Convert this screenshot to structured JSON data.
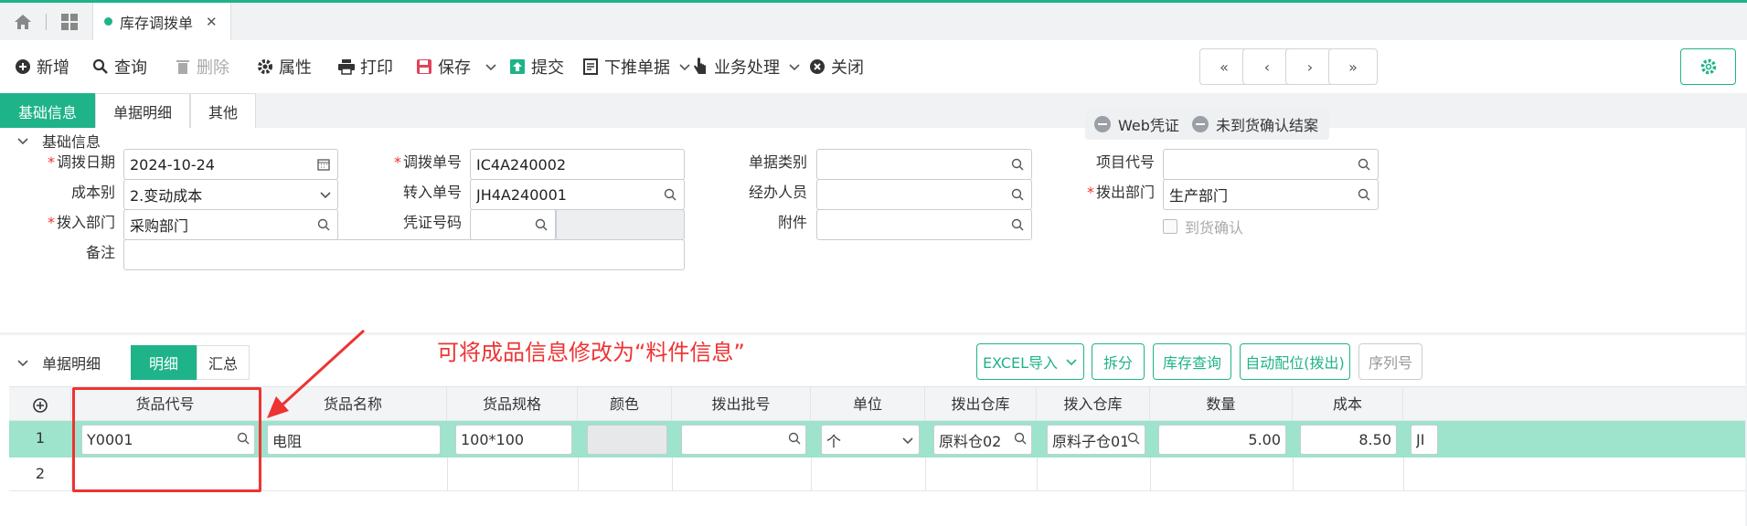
{
  "tabbar": {
    "active_tab": "库存调拨单",
    "close_glyph": "✕"
  },
  "toolbar": {
    "buttons": [
      "新增",
      "查询",
      "删除",
      "属性",
      "打印",
      "保存",
      "提交",
      "下推单据",
      "业务处理",
      "关闭"
    ],
    "nav": [
      "«",
      "‹",
      "›",
      "»"
    ]
  },
  "subtabs": [
    "基础信息",
    "单据明细",
    "其他"
  ],
  "basic": {
    "section_title": "基础信息",
    "pills": [
      "Web凭证",
      "未到货确认结案"
    ],
    "fields": {
      "date_label": "调拨日期",
      "date_value": "2024-10-24",
      "cost_label": "成本别",
      "cost_value": "2.变动成本",
      "in_dept_label": "拨入部门",
      "in_dept_value": "采购部门",
      "remark_label": "备注",
      "remark_value": "",
      "no_label": "调拨单号",
      "no_value": "IC4A240002",
      "in_no_label": "转入单号",
      "in_no_value": "JH4A240001",
      "voucher_label": "凭证号码",
      "voucher_value": "",
      "category_label": "单据类别",
      "category_value": "",
      "handler_label": "经办人员",
      "handler_value": "",
      "attach_label": "附件",
      "attach_value": "",
      "project_label": "项目代号",
      "project_value": "",
      "out_dept_label": "拨出部门",
      "out_dept_value": "生产部门",
      "arrive_label": "到货确认"
    }
  },
  "detail": {
    "section_title": "单据明细",
    "seg": [
      "明细",
      "汇总"
    ],
    "buttons": [
      "EXCEL导入",
      "拆分",
      "库存查询",
      "自动配位(拨出)",
      "序列号"
    ],
    "annotation": "可将成品信息修改为“料件信息”",
    "columns": [
      "货品代号",
      "货品名称",
      "货品规格",
      "颜色",
      "拨出批号",
      "单位",
      "拨出仓库",
      "拨入仓库",
      "数量",
      "成本"
    ],
    "rows": [
      {
        "no": "1",
        "code": "Y0001",
        "name": "电阻",
        "spec": "100*100",
        "color": "",
        "batch": "",
        "unit": "个",
        "out_wh": "原料仓02",
        "in_wh": "原料子仓01",
        "qty": "5.00",
        "cost": "8.50",
        "extra": "JI"
      },
      {
        "no": "2"
      }
    ]
  },
  "colors": {
    "accent": "#1fb389",
    "annotation": "#e33333",
    "selected_row": "#9ee3cc"
  }
}
